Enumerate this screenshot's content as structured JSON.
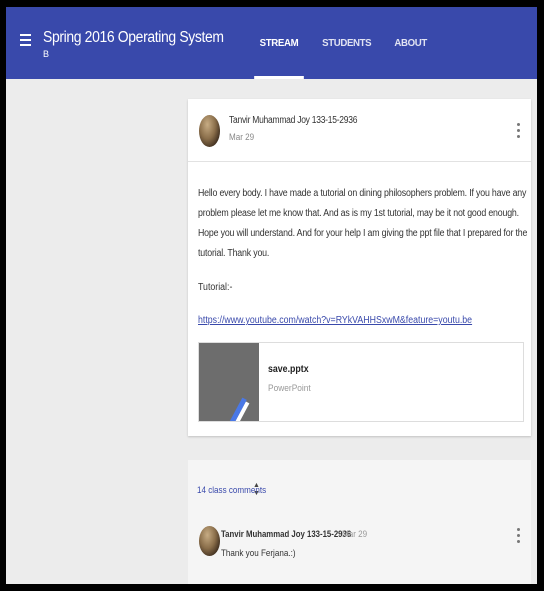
{
  "header": {
    "course_title": "Spring 2016 Operating System",
    "course_section": "B",
    "tabs": [
      {
        "label": "STREAM",
        "active": true
      },
      {
        "label": "STUDENTS",
        "active": false
      },
      {
        "label": "ABOUT",
        "active": false
      }
    ],
    "accent_color": "#3949ab"
  },
  "post": {
    "author": "Tanvir Muhammad Joy 133-15-2936",
    "date": "Mar 29",
    "text": "Hello every body. I have made a tutorial on dining philosophers problem. If you have any problem please let me know that. And as is my 1st tutorial, may be it not good enough. Hope you will understand. And for your help I am giving the ppt file that I prepared for the tutorial. Thank you.",
    "tutorial_label": "Tutorial:-",
    "link": "https://www.youtube.com/watch?v=RYkVAHHSxwM&feature=youtu.be",
    "attachment": {
      "name": "save.pptx",
      "type": "PowerPoint"
    }
  },
  "comments": {
    "count_label": "14 class comments",
    "items": [
      {
        "author": "Tanvir Muhammad Joy 133-15-2936",
        "date": "Mar 29",
        "text": "Thank you Ferjana.:)"
      }
    ]
  }
}
